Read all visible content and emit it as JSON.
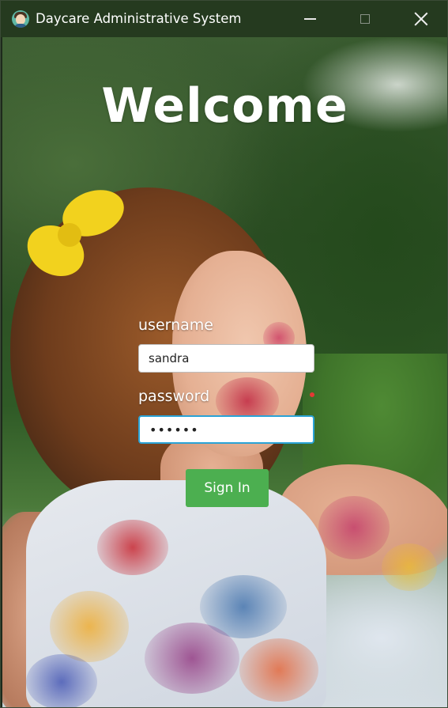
{
  "window": {
    "title": "Daycare Administrative System",
    "icon": "child-avatar-icon",
    "controls": {
      "minimize": "minimize-icon",
      "maximize": "maximize-icon",
      "close": "close-icon"
    }
  },
  "login": {
    "heading": "Welcome",
    "username_label": "username",
    "username_value": "sandra",
    "password_label": "password",
    "password_value": "••••••",
    "submit_label": "Sign In"
  },
  "colors": {
    "title_bar": "#253a1f",
    "button": "#4caf50",
    "focus_border": "#2aa3d6",
    "error_dot": "#e53935"
  }
}
